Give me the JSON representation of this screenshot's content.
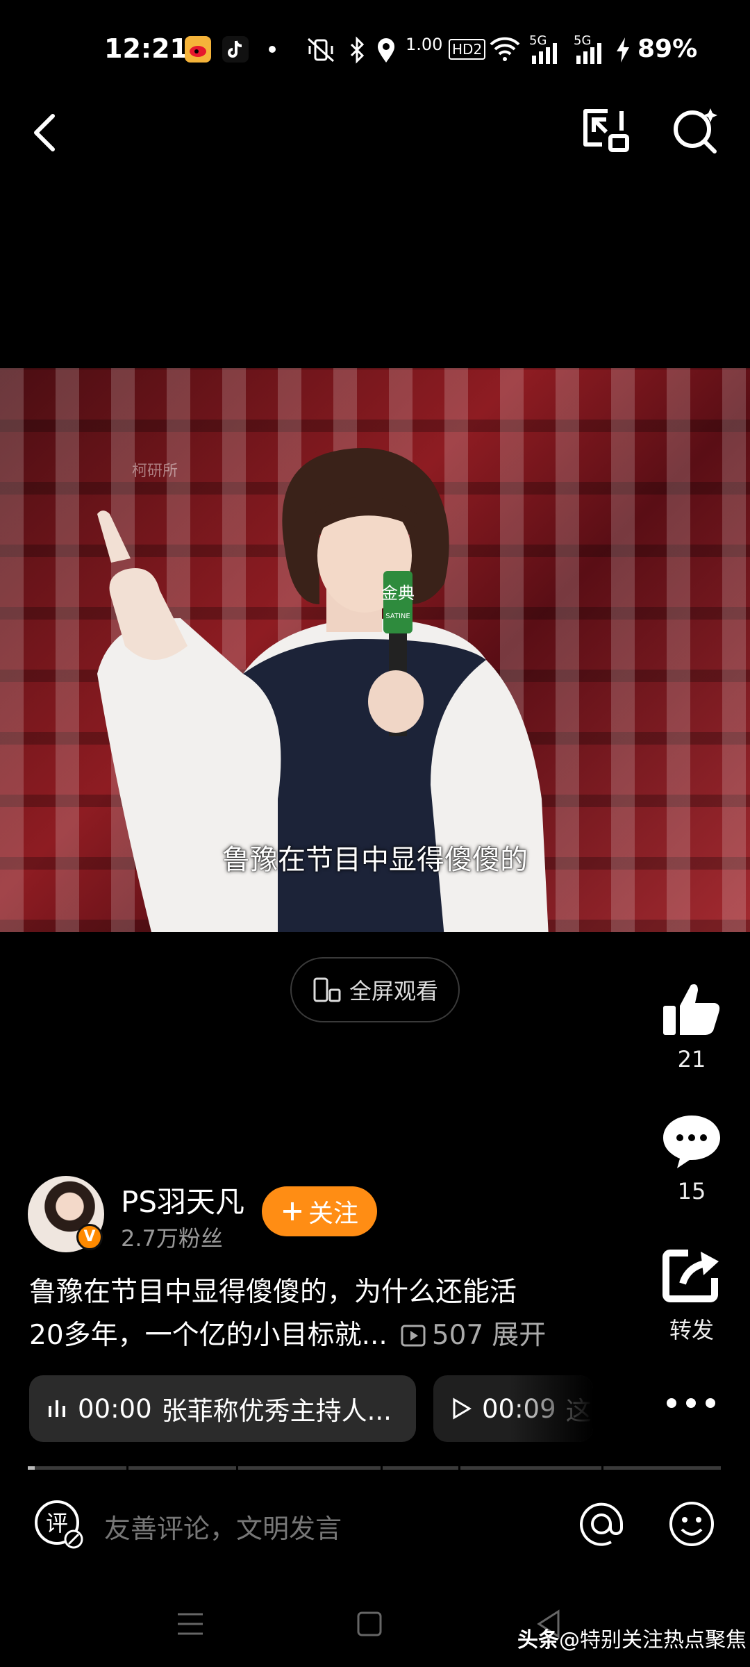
{
  "status_bar": {
    "time": "12:21",
    "network_speed": "1.00",
    "hd": "HD2",
    "signal1": "5G",
    "signal2": "5G",
    "battery": "89%"
  },
  "video": {
    "watermark": "柯研所",
    "mic_brand_main": "金典",
    "mic_brand_sub": "SATINE",
    "caption": "鲁豫在节目中显得傻傻的"
  },
  "fullscreen_label": "全屏观看",
  "actions": {
    "like_count": "21",
    "comment_count": "15",
    "share_label": "转发"
  },
  "author": {
    "name": "PS羽天凡",
    "fans": "2.7万粉丝",
    "verified_mark": "V",
    "follow_label": "关注"
  },
  "description": {
    "line1": "鲁豫在节目中显得傻傻的，为什么还能活",
    "line2": "20多年，一个亿的小目标就...",
    "play_count": "507",
    "expand_label": "展开"
  },
  "chips": [
    {
      "time": "00:00",
      "text": "张菲称优秀主持人..."
    },
    {
      "time": "00:09",
      "text": "这"
    }
  ],
  "progress": {
    "fraction": 0.01
  },
  "comment_bar": {
    "placeholder": "友善评论，文明发言",
    "comment_icon_char": "评"
  },
  "watermark_bottom": {
    "brand": "头条",
    "handle": "@特别关注热点聚焦"
  },
  "colors": {
    "accent": "#ff8d14",
    "background": "#000000"
  }
}
